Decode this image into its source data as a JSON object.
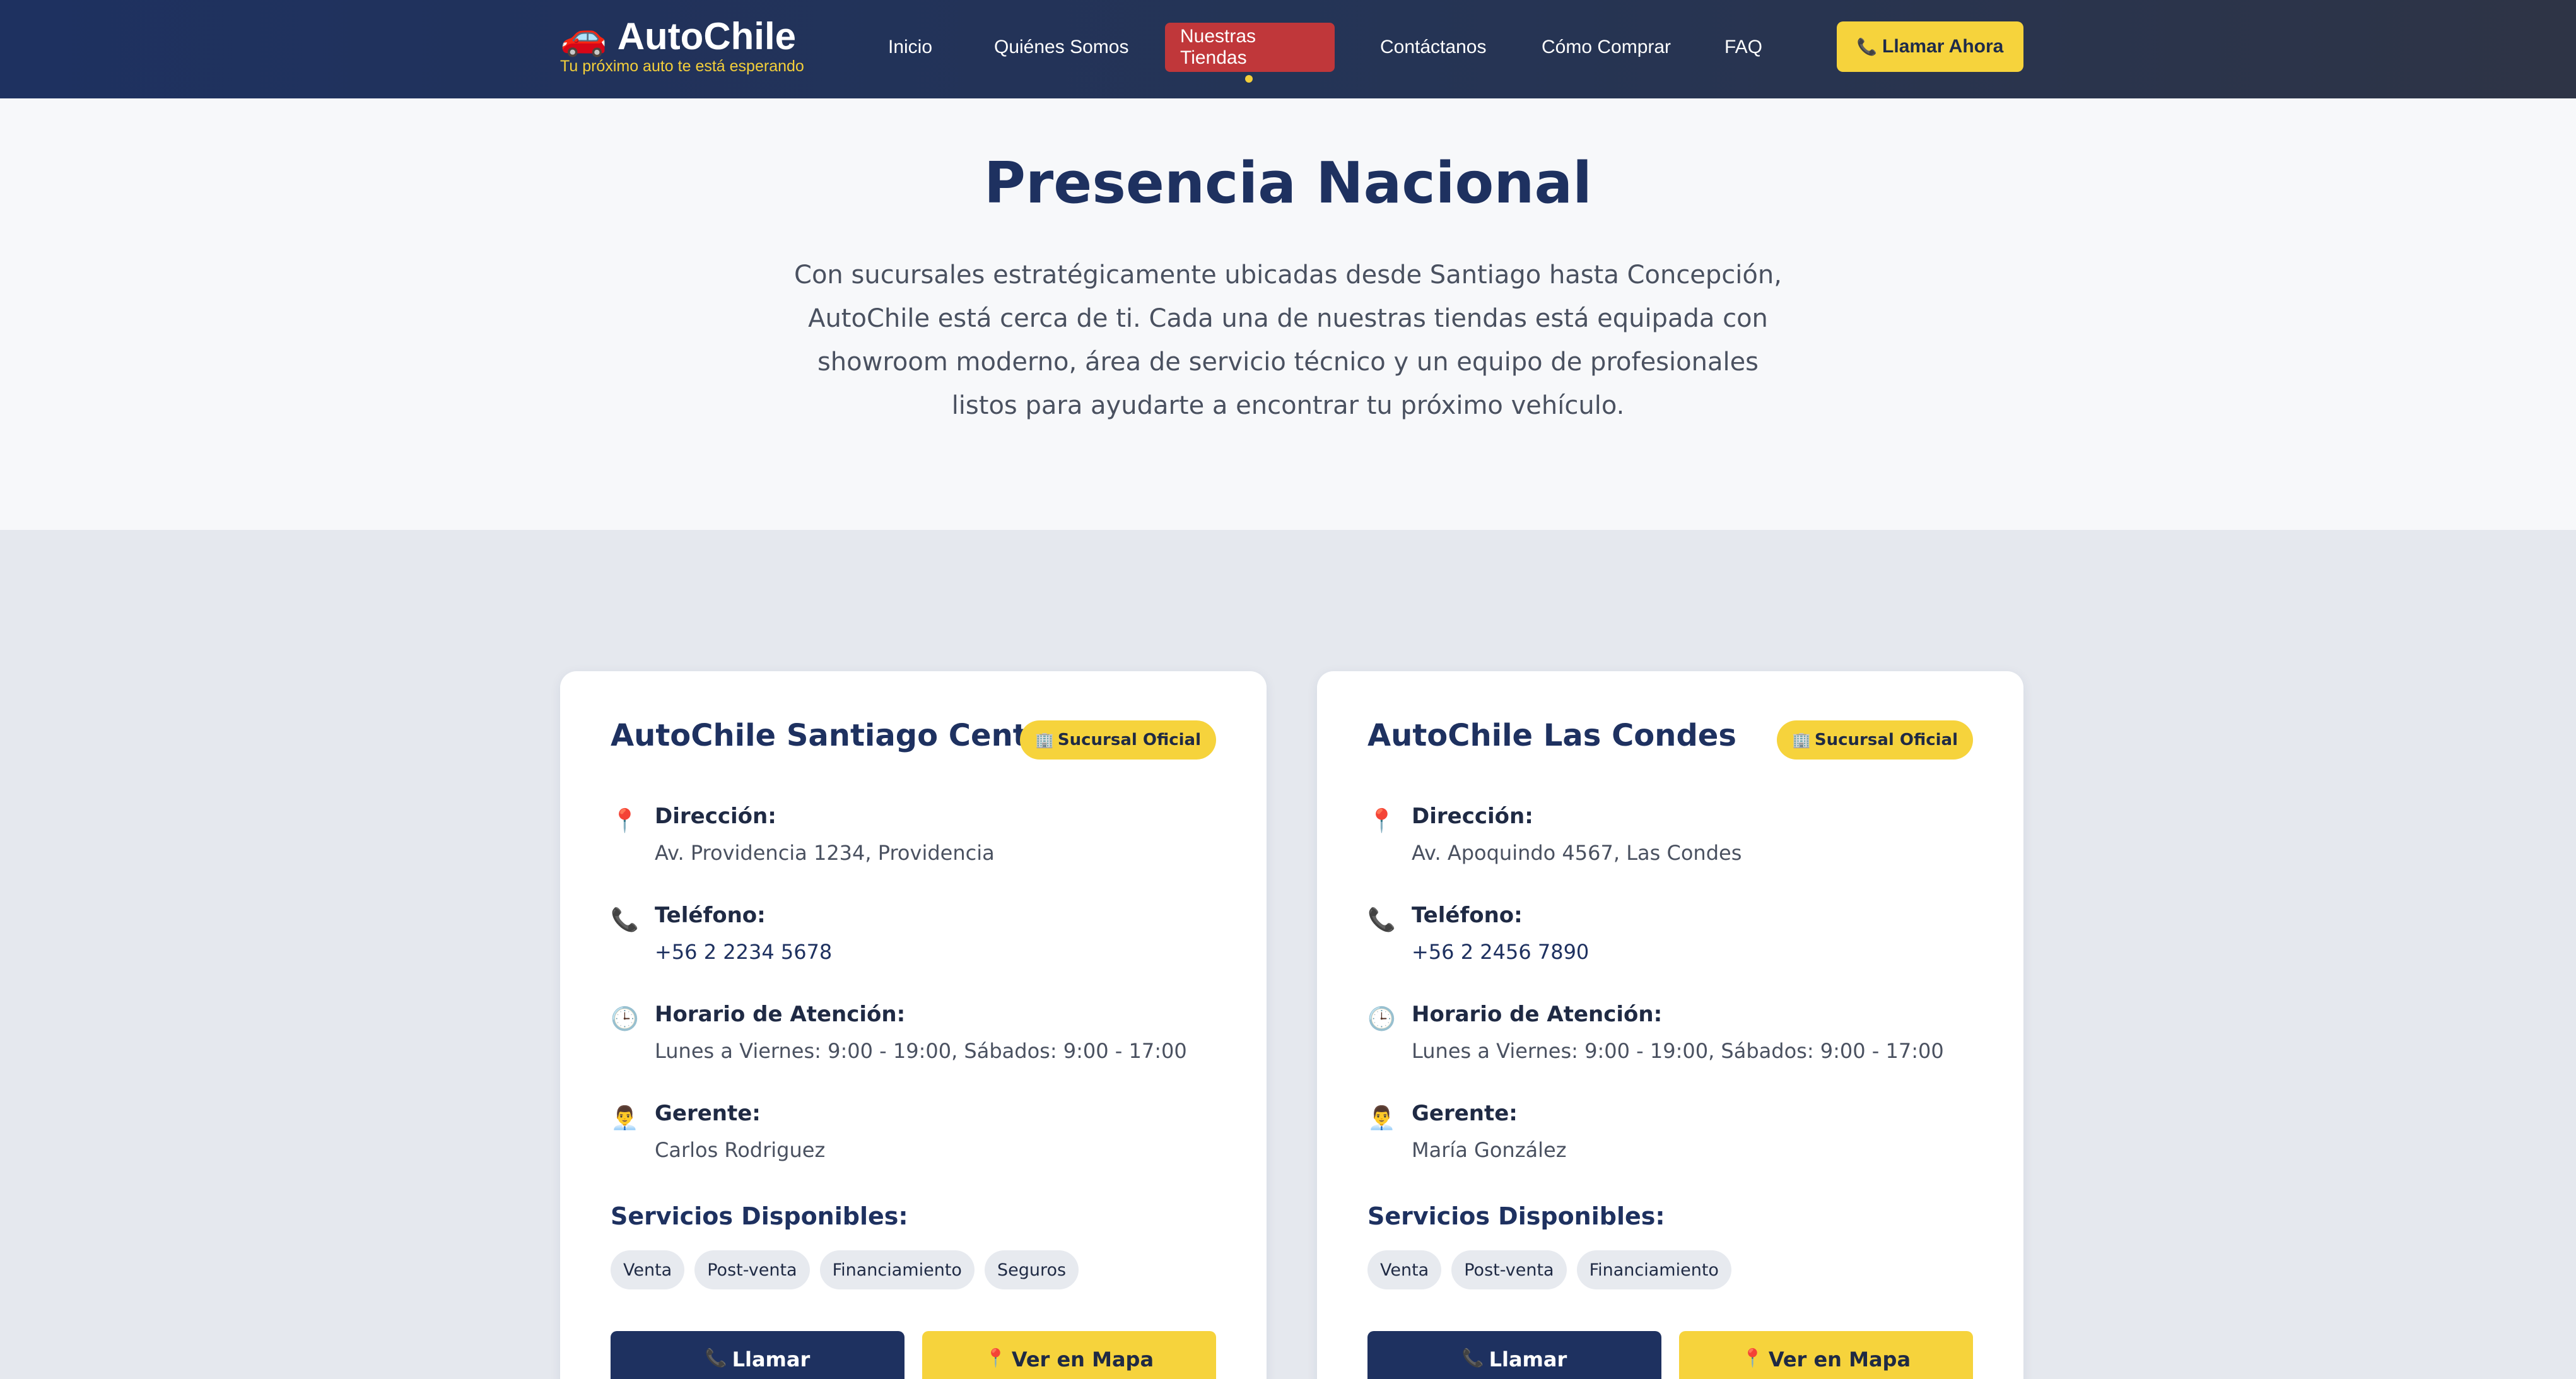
{
  "header": {
    "brand_icon": "🚗",
    "brand_name": "AutoChile",
    "tagline": "Tu próximo auto te está esperando",
    "nav": [
      {
        "label": "Inicio",
        "active": false
      },
      {
        "label": "Quiénes Somos",
        "active": false
      },
      {
        "label": "Nuestras Tiendas",
        "active": true
      },
      {
        "label": "Contáctanos",
        "active": false
      },
      {
        "label": "Cómo Comprar",
        "active": false
      },
      {
        "label": "FAQ",
        "active": false
      }
    ],
    "cta_icon": "📞",
    "cta_label": "Llamar Ahora"
  },
  "hero": {
    "title": "Presencia Nacional",
    "text": "Con sucursales estratégicamente ubicadas desde Santiago hasta Concepción, AutoChile está cerca de ti. Cada una de nuestras tiendas está equipada con showroom moderno, área de servicio técnico y un equipo de profesionales listos para ayudarte a encontrar tu próximo vehículo."
  },
  "labels": {
    "address": "Dirección:",
    "phone": "Teléfono:",
    "hours": "Horario de Atención:",
    "manager": "Gerente:",
    "services": "Servicios Disponibles:",
    "call": "Llamar",
    "map": "Ver en Mapa"
  },
  "icons": {
    "address": "📍",
    "phone": "📞",
    "hours": "🕒",
    "manager": "👨‍💼",
    "badge": "🏢",
    "call": "📞",
    "map": "📍"
  },
  "stores": [
    {
      "name": "AutoChile Santiago Centro",
      "badge": "Sucursal Oficial",
      "address": "Av. Providencia 1234, Providencia",
      "phone": "+56 2 2234 5678",
      "hours": "Lunes a Viernes: 9:00 - 19:00, Sábados: 9:00 - 17:00",
      "manager": "Carlos Rodriguez",
      "services": [
        "Venta",
        "Post-venta",
        "Financiamiento",
        "Seguros"
      ]
    },
    {
      "name": "AutoChile Las Condes",
      "badge": "Sucursal Oficial",
      "address": "Av. Apoquindo 4567, Las Condes",
      "phone": "+56 2 2456 7890",
      "hours": "Lunes a Viernes: 9:00 - 19:00, Sábados: 9:00 - 17:00",
      "manager": "María González",
      "services": [
        "Venta",
        "Post-venta",
        "Financiamiento"
      ]
    }
  ],
  "colors": {
    "navy": "#1e3160",
    "accent_yellow": "#f6d33c",
    "active_red": "#c0373a",
    "page_bg": "#e5e8ee"
  }
}
